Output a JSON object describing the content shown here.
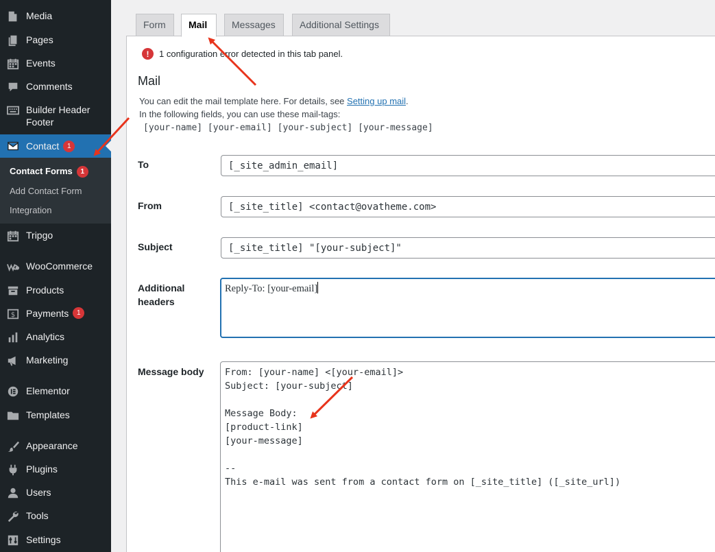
{
  "sidebar": {
    "items": [
      {
        "label": "Media",
        "icon": "media-icon"
      },
      {
        "label": "Pages",
        "icon": "pages-icon"
      },
      {
        "label": "Events",
        "icon": "calendar-icon"
      },
      {
        "label": "Comments",
        "icon": "comment-icon"
      },
      {
        "label": "Builder Header Footer",
        "icon": "keyboard-icon"
      },
      {
        "label": "Contact",
        "icon": "mail-icon",
        "badge": "1"
      },
      {
        "label": "Tripgo",
        "icon": "calendar-icon"
      },
      {
        "label": "WooCommerce",
        "icon": "woocommerce-icon"
      },
      {
        "label": "Products",
        "icon": "archive-icon"
      },
      {
        "label": "Payments",
        "icon": "dollar-icon",
        "badge": "1"
      },
      {
        "label": "Analytics",
        "icon": "chart-icon"
      },
      {
        "label": "Marketing",
        "icon": "megaphone-icon"
      },
      {
        "label": "Elementor",
        "icon": "elementor-icon"
      },
      {
        "label": "Templates",
        "icon": "folder-icon"
      },
      {
        "label": "Appearance",
        "icon": "brush-icon"
      },
      {
        "label": "Plugins",
        "icon": "plugin-icon"
      },
      {
        "label": "Users",
        "icon": "user-icon"
      },
      {
        "label": "Tools",
        "icon": "wrench-icon"
      },
      {
        "label": "Settings",
        "icon": "settings-icon"
      }
    ],
    "submenu": [
      {
        "label": "Contact Forms",
        "badge": "1"
      },
      {
        "label": "Add Contact Form"
      },
      {
        "label": "Integration"
      }
    ]
  },
  "tabs": [
    "Form",
    "Mail",
    "Messages",
    "Additional Settings"
  ],
  "panel": {
    "config_error": "1 configuration error detected in this tab panel.",
    "heading": "Mail",
    "description_prefix": "You can edit the mail template here. For details, see ",
    "description_link": "Setting up mail",
    "description_suffix": ".",
    "tags_intro": "In the following fields, you can use these mail-tags:",
    "mail_tags": "[your-name] [your-email] [your-subject] [your-message]",
    "fields": {
      "to_label": "To",
      "to_value": "[_site_admin_email]",
      "from_label": "From",
      "from_value": "[_site_title] <contact@ovatheme.com>",
      "subject_label": "Subject",
      "subject_value": "[_site_title] \"[your-subject]\"",
      "headers_label_line1": "Additional",
      "headers_label_line2": "headers",
      "headers_value": "Reply-To: [your-email]",
      "body_label": "Message body",
      "body_value": "From: [your-name] <[your-email]>\nSubject: [your-subject]\n\nMessage Body:\n[product-link]\n[your-message]\n\n--\nThis e-mail was sent from a contact form on [_site_title] ([_site_url])"
    }
  },
  "colors": {
    "sidebar_bg": "#1d2327",
    "accent": "#2271b1",
    "badge": "#d63638",
    "annotation_arrow": "#e8341c"
  }
}
